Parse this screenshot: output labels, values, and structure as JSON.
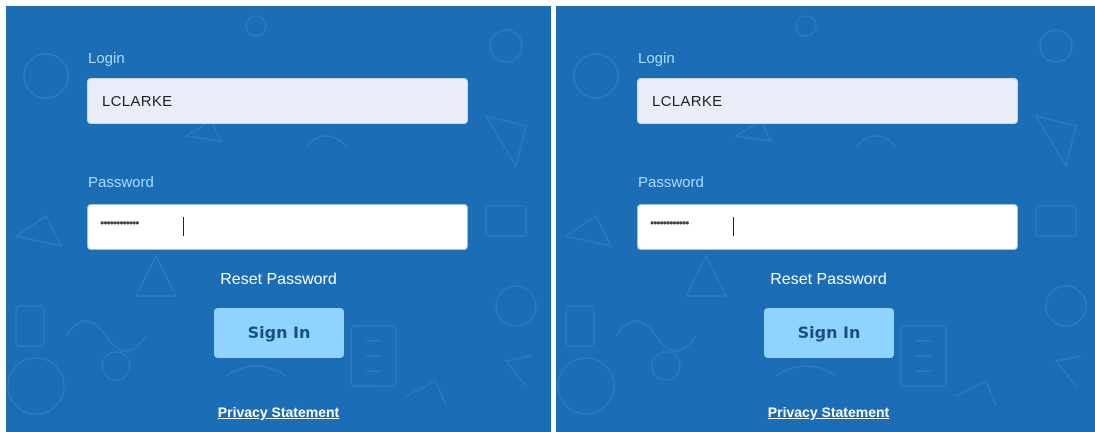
{
  "colors": {
    "background": "#1b6db5",
    "label": "#a9dcff",
    "button": "#8fd3ff",
    "button_text": "#1a4f80",
    "link": "#ffffff"
  },
  "panels": [
    {
      "login_label": "Login",
      "login_value": "LCLARKE",
      "password_label": "Password",
      "password_mask": "••••••••••••",
      "reset_label": "Reset Password",
      "signin_label": "Sign In",
      "privacy_label": "Privacy Statement"
    },
    {
      "login_label": "Login",
      "login_value": "LCLARKE",
      "password_label": "Password",
      "password_mask": "••••••••••••",
      "reset_label": "Reset Password",
      "signin_label": "Sign In",
      "privacy_label": "Privacy Statement"
    }
  ]
}
